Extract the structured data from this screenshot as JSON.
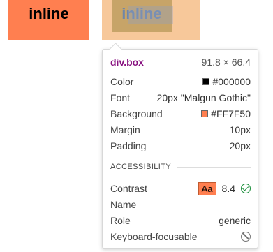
{
  "boxes": {
    "box1_text": "inline",
    "box2_text": "inline"
  },
  "tooltip": {
    "selector": "div.box",
    "dimensions": "91.8 × 66.4",
    "rows": {
      "color": {
        "label": "Color",
        "value": "#000000",
        "swatch": "#000000"
      },
      "font": {
        "label": "Font",
        "value": "20px \"Malgun Gothic\""
      },
      "background": {
        "label": "Background",
        "value": "#FF7F50",
        "swatch": "#FF7F50"
      },
      "margin": {
        "label": "Margin",
        "value": "10px"
      },
      "padding": {
        "label": "Padding",
        "value": "20px"
      }
    },
    "accessibility": {
      "heading": "ACCESSIBILITY",
      "contrast": {
        "label": "Contrast",
        "badge": "Aa",
        "value": "8.4"
      },
      "name": {
        "label": "Name",
        "value": ""
      },
      "role": {
        "label": "Role",
        "value": "generic"
      },
      "keyboard": {
        "label": "Keyboard-focusable"
      }
    }
  }
}
